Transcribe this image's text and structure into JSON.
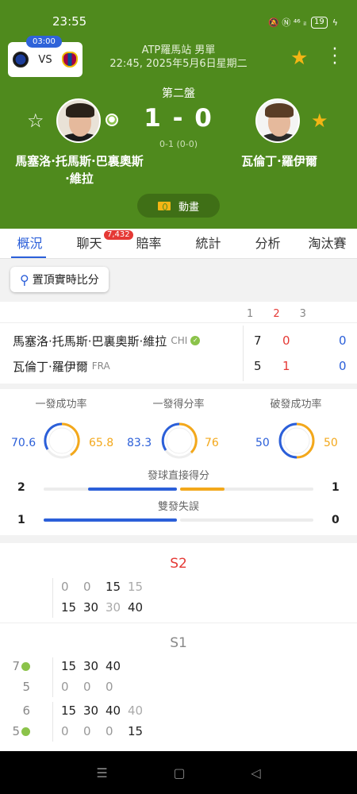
{
  "status": {
    "time": "23:55",
    "icons": "🔕 Ⓝ ⁴⁶ ᵢₗ",
    "battery": "19"
  },
  "header": {
    "mini_clock": "03:00",
    "mini_vs": "VS",
    "tournament_line1": "ATP羅馬站 男單",
    "tournament_line2": "22:45, 2025年5月6日星期二",
    "set_label": "第二盤",
    "score": "1 - 0",
    "sub_score": "0-1 (0-0)",
    "player1_name": "馬塞洛·托馬斯·巴裏奧斯·維拉",
    "player2_name": "瓦倫丁·羅伊爾",
    "animation_label": "動畫"
  },
  "tabs": [
    {
      "label": "概況"
    },
    {
      "label": "聊天",
      "badge": "7,432"
    },
    {
      "label": "賠率"
    },
    {
      "label": "統計"
    },
    {
      "label": "分析"
    },
    {
      "label": "淘汰賽"
    }
  ],
  "pin_button": "置頂實時比分",
  "scoreboard": {
    "set_headers": [
      "1",
      "2",
      "3"
    ],
    "rows": [
      {
        "name": "馬塞洛·托馬斯·巴裏奧斯·維拉",
        "country": "CHI",
        "s1": "7",
        "s2": "0",
        "points": "0"
      },
      {
        "name": "瓦倫丁·羅伊爾",
        "country": "FRA",
        "s1": "5",
        "s2": "1",
        "points": "0"
      }
    ]
  },
  "stats": {
    "rings": [
      {
        "title": "一發成功率",
        "left": "70.6",
        "right": "65.8"
      },
      {
        "title": "一發得分率",
        "left": "83.3",
        "right": "76"
      },
      {
        "title": "破發成功率",
        "left": "50",
        "right": "50"
      }
    ],
    "bars": [
      {
        "title": "發球直接得分",
        "left": "2",
        "right": "1"
      },
      {
        "title": "雙發失誤",
        "left": "1",
        "right": "0"
      }
    ]
  },
  "pbp": {
    "set2_label": "S2",
    "set2_game": {
      "top": [
        "0",
        "0",
        "15",
        "15"
      ],
      "bottom": [
        "15",
        "30",
        "30",
        "40"
      ]
    },
    "set1_label": "S1",
    "set1_games": [
      {
        "g_top": "7",
        "g_bottom": "5",
        "top": [
          "15",
          "30",
          "40"
        ],
        "bottom": [
          "0",
          "0",
          "0"
        ]
      },
      {
        "g_top": "6",
        "g_bottom": "5",
        "top": [
          "15",
          "30",
          "40",
          "40"
        ],
        "bottom": [
          "0",
          "0",
          "0",
          "15"
        ]
      }
    ]
  },
  "nav": {
    "menu": "☰",
    "home": "▢",
    "back": "◁"
  },
  "colors": {
    "header_green": "#4f8a1d",
    "accent_blue": "#2b5fd9",
    "accent_orange": "#f3a81b",
    "red": "#e53935",
    "gold_star": "#f3b515"
  }
}
